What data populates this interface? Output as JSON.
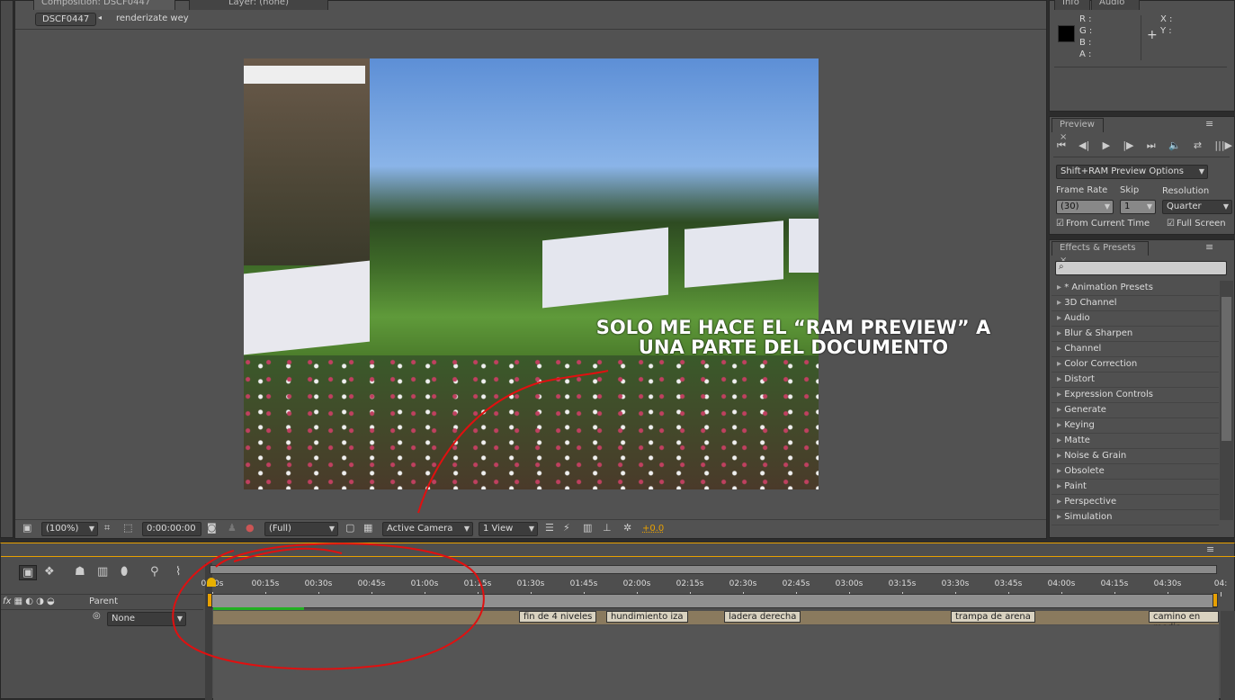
{
  "composition": {
    "tab_label": "Composition: DSCF0447",
    "layer_tab": "Layer: (none)",
    "breadcrumb_comp": "DSCF0447",
    "breadcrumb_next": "renderizate wey"
  },
  "viewer_toolbar": {
    "zoom": "(100%)",
    "timecode": "0:00:00:00",
    "resolution": "(Full)",
    "camera": "Active Camera",
    "views": "1 View",
    "exposure": "+0.0"
  },
  "annotation": {
    "line1": "SOLO ME HACE EL “RAM PREVIEW” A",
    "line2": "UNA PARTE DEL DOCUMENTO",
    "color": "#e01010"
  },
  "info": {
    "tab": "Info",
    "tab2": "Audio",
    "r": "R :",
    "g": "G :",
    "b": "B :",
    "a": "A :",
    "x": "X :",
    "y": "Y :"
  },
  "preview": {
    "tab": "Preview",
    "options": "Shift+RAM Preview Options",
    "frame_rate_label": "Frame Rate",
    "skip_label": "Skip",
    "resolution_label": "Resolution",
    "frame_rate": "(30)",
    "skip": "1",
    "resolution": "Quarter",
    "from_current": "From Current Time",
    "full_screen": "Full Screen"
  },
  "effects": {
    "tab": "Effects & Presets",
    "items": [
      "* Animation Presets",
      "3D Channel",
      "Audio",
      "Blur & Sharpen",
      "Channel",
      "Color Correction",
      "Distort",
      "Expression Controls",
      "Generate",
      "Keying",
      "Matte",
      "Noise & Grain",
      "Obsolete",
      "Paint",
      "Perspective",
      "Simulation"
    ]
  },
  "timeline": {
    "parent_label": "Parent",
    "parent_value": "None",
    "ticks": [
      "0:00s",
      "00:15s",
      "00:30s",
      "00:45s",
      "01:00s",
      "01:15s",
      "01:30s",
      "01:45s",
      "02:00s",
      "02:15s",
      "02:30s",
      "02:45s",
      "03:00s",
      "03:15s",
      "03:30s",
      "03:45s",
      "04:00s",
      "04:15s",
      "04:30s",
      "04:"
    ],
    "markers": [
      "fin de 4 niveles",
      "hundimiento iza",
      "ladera derecha",
      "trampa de arena",
      "camino en medio"
    ],
    "ram_preview_fraction": 0.09,
    "accent": "#e8a000"
  }
}
